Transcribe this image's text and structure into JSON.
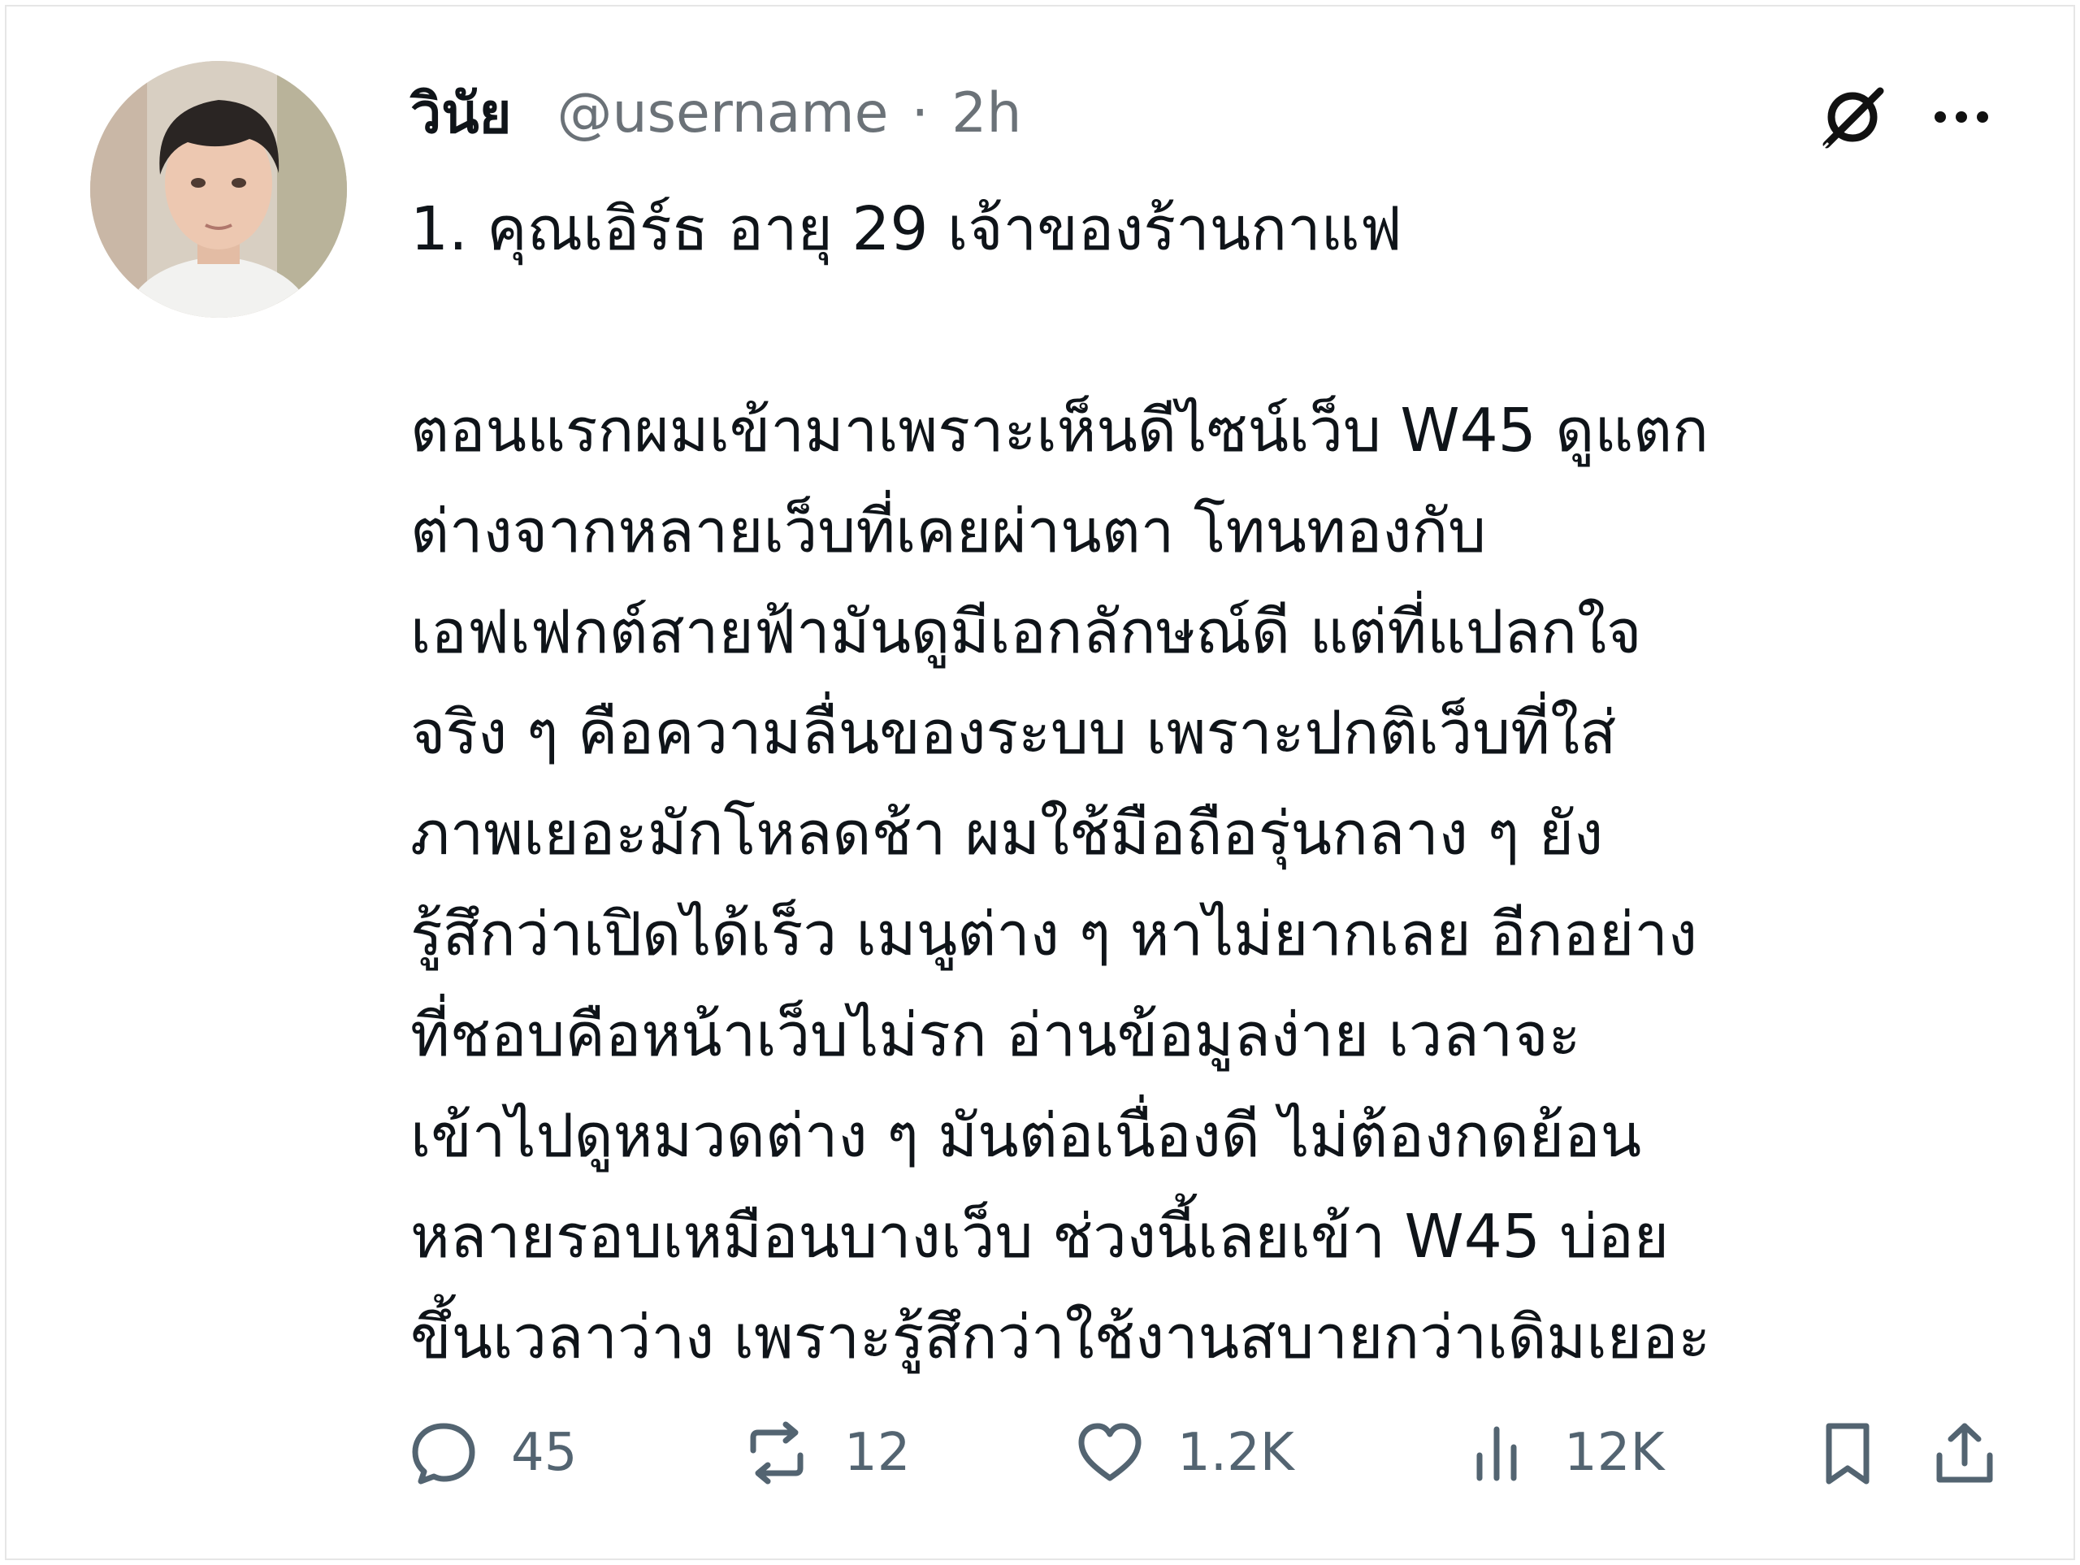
{
  "post": {
    "display_name": "วินัย",
    "handle": "@username",
    "separator": "·",
    "time": "2h",
    "first_line": "1. คุณเอิร์ธ อายุ 29 เจ้าของร้านกาแฟ",
    "paragraph": "ตอนแรกผมเข้ามาเพราะเห็นดีไซน์เว็บ W45 ดูแตก\nต่างจากหลายเว็บที่เคยผ่านตา โทนทองกับ\nเอฟเฟกต์สายฟ้ามันดูมีเอกลักษณ์ดี แต่ที่แปลกใจ\nจริง ๆ คือความลื่นของระบบ เพราะปกติเว็บที่ใส่\nภาพเยอะมักโหลดช้า ผมใช้มือถือรุ่นกลาง ๆ ยัง\nรู้สึกว่าเปิดได้เร็ว เมนูต่าง ๆ หาไม่ยากเลย อีกอย่าง\nที่ชอบคือหน้าเว็บไม่รก อ่านข้อมูลง่าย เวลาจะ\nเข้าไปดูหมวดต่าง ๆ มันต่อเนื่องดี ไม่ต้องกดย้อน\nหลายรอบเหมือนบางเว็บ ช่วงนี้เลยเข้า W45 บ่อย\nขึ้นเวลาว่าง เพราะรู้สึกว่าใช้งานสบายกว่าเดิมเยอะ"
  },
  "header_icons": {
    "grok": "grok-icon",
    "more": "more-icon"
  },
  "actions": {
    "reply_count": "45",
    "repost_count": "12",
    "like_count": "1.2K",
    "views_count": "12K"
  },
  "colors": {
    "text": "#0f1419",
    "secondary": "#6b7278",
    "action": "#536471"
  }
}
